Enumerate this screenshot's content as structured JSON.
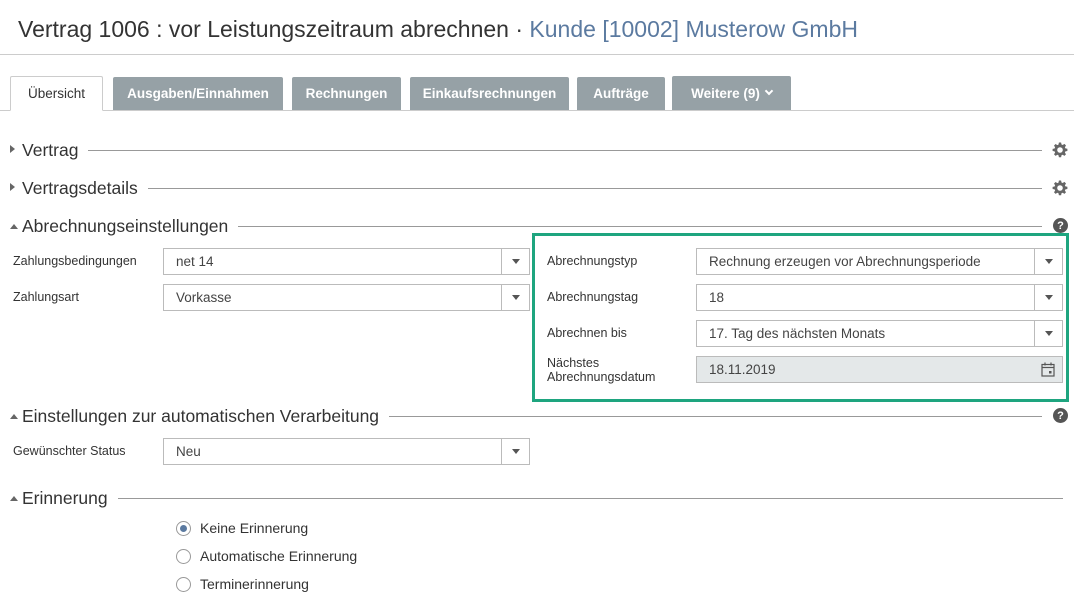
{
  "header": {
    "title": "Vertrag 1006 : vor Leistungszeitraum abrechnen",
    "separator": "·",
    "customer_link": "Kunde [10002] Musterow GmbH"
  },
  "tabs": [
    {
      "label": "Übersicht",
      "active": true
    },
    {
      "label": "Ausgaben/Einnahmen"
    },
    {
      "label": "Rechnungen"
    },
    {
      "label": "Einkaufsrechnungen"
    },
    {
      "label": "Aufträge"
    },
    {
      "label": "Weitere (9)"
    }
  ],
  "sections": {
    "vertrag": "Vertrag",
    "vertragsdetails": "Vertragsdetails",
    "abrechnung": "Abrechnungseinstellungen",
    "automatik": "Einstellungen zur automatischen Verarbeitung",
    "erinnerung": "Erinnerung"
  },
  "abrechnung": {
    "zahlungsbedingungen": {
      "label": "Zahlungsbedingungen",
      "value": "net 14"
    },
    "zahlungsart": {
      "label": "Zahlungsart",
      "value": "Vorkasse"
    },
    "abrechnungstyp": {
      "label": "Abrechnungstyp",
      "value": "Rechnung erzeugen vor Abrechnungsperiode"
    },
    "abrechnungstag": {
      "label": "Abrechnungstag",
      "value": "18"
    },
    "abrechnen_bis": {
      "label": "Abrechnen bis",
      "value": "17. Tag des nächsten Monats"
    },
    "naechstes_datum": {
      "label_line1": "Nächstes",
      "label_line2": "Abrechnungsdatum",
      "value": "18.11.2019"
    }
  },
  "automatik": {
    "status": {
      "label": "Gewünschter Status",
      "value": "Neu"
    }
  },
  "erinnerung": {
    "options": [
      {
        "label": "Keine Erinnerung",
        "checked": true
      },
      {
        "label": "Automatische Erinnerung",
        "checked": false
      },
      {
        "label": "Terminerinnerung",
        "checked": false
      }
    ]
  },
  "icons": {
    "help": "?",
    "settings": "gear-icon",
    "calendar": "calendar-icon"
  },
  "colors": {
    "highlight": "#1ea57f",
    "link": "#5b7aa0",
    "tab_bg": "#96a1a6"
  }
}
